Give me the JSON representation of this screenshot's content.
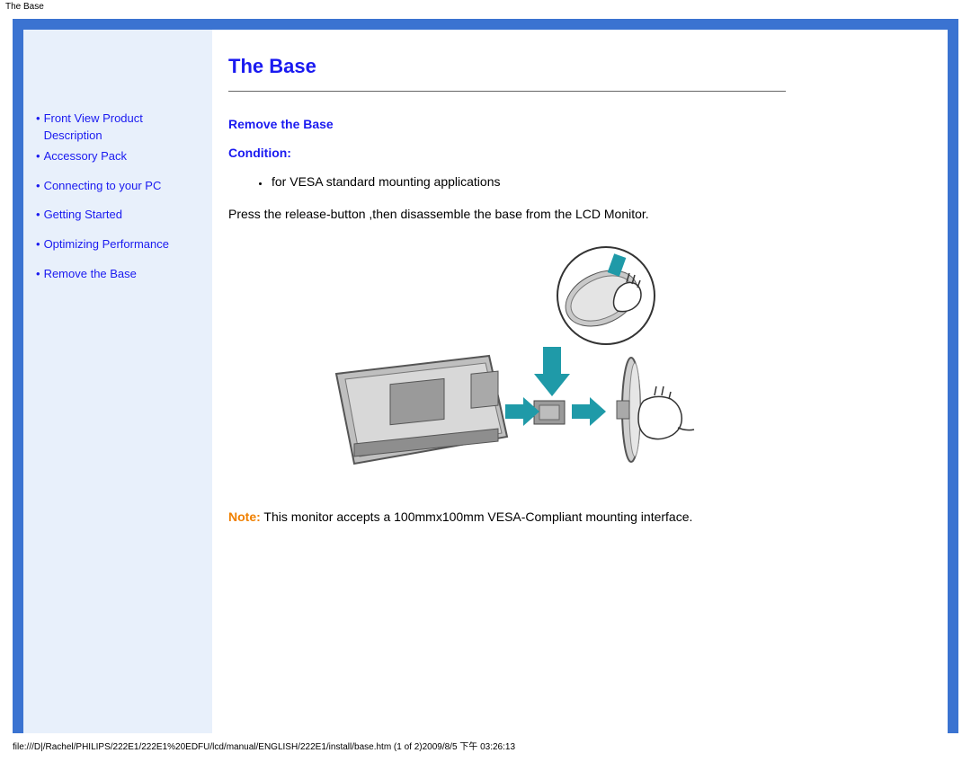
{
  "top_label": "The Base",
  "sidebar": {
    "items": [
      {
        "label": "Front View Product Description"
      },
      {
        "label": "Accessory Pack"
      },
      {
        "label": "Connecting to your PC"
      },
      {
        "label": "Getting Started"
      },
      {
        "label": "Optimizing Performance"
      },
      {
        "label": "Remove the Base"
      }
    ]
  },
  "main": {
    "title": "The Base",
    "section1": "Remove the Base",
    "section2": "Condition:",
    "bullet1": "for VESA standard mounting applications",
    "instruction": "Press the release-button ,then disassemble the base from the LCD Monitor.",
    "note_label": "Note:",
    "note_text": " This monitor accepts a 100mmx100mm VESA-Compliant mounting interface."
  },
  "footer": "file:///D|/Rachel/PHILIPS/222E1/222E1%20EDFU/lcd/manual/ENGLISH/222E1/install/base.htm (1 of 2)2009/8/5 下午 03:26:13"
}
